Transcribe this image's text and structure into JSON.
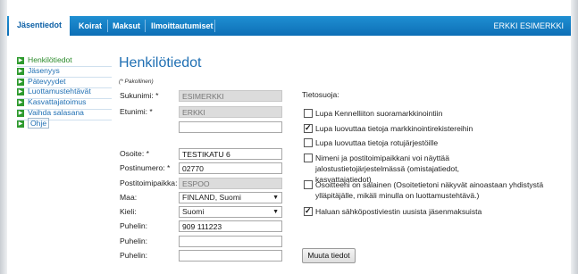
{
  "nav": {
    "tabs": [
      {
        "label": "Jäsentiedot"
      },
      {
        "label": "Koirat"
      },
      {
        "label": "Maksut"
      },
      {
        "label": "Ilmoittautumiset"
      }
    ],
    "user": "ERKKI ESIMERKKI"
  },
  "sidebar": {
    "items": [
      {
        "label": "Henkilötiedot"
      },
      {
        "label": "Jäsenyys"
      },
      {
        "label": "Pätevyydet"
      },
      {
        "label": "Luottamustehtävät"
      },
      {
        "label": "Kasvattajatoimus"
      },
      {
        "label": "Vaihda salasana"
      },
      {
        "label": "Ohje"
      }
    ]
  },
  "page": {
    "title": "Henkilötiedot",
    "required_note": "(* Pakollinen)"
  },
  "form": {
    "sukunimi_label": "Sukunimi: *",
    "sukunimi_value": "ESIMERKKI",
    "etunimi_label": "Etunimi: *",
    "etunimi_value": "ERKKI",
    "extra_name_value": "",
    "osoite_label": "Osoite: *",
    "osoite_value": "TESTIKATU 6",
    "postinumero_label": "Postinumero: *",
    "postinumero_value": "02770",
    "postitoimipaikka_label": "Postitoimipaikka:",
    "postitoimipaikka_value": "ESPOO",
    "maa_label": "Maa:",
    "maa_value": "FINLAND, Suomi",
    "kieli_label": "Kieli:",
    "kieli_value": "Suomi",
    "puhelin_label": "Puhelin:",
    "puhelin1_value": "909 111223",
    "puhelin2_value": "",
    "puhelin3_value": ""
  },
  "privacy": {
    "title": "Tietosuoja:",
    "options": [
      {
        "text": "Lupa Kennelliiton suoramarkkinointiin",
        "checked": false
      },
      {
        "text": "Lupa luovuttaa tietoja markkinointirekistereihin",
        "checked": true
      },
      {
        "text": "Lupa luovuttaa tietoja rotujärjestöille",
        "checked": false
      },
      {
        "text": "Nimeni ja postitoimipaikkani voi näyttää jalostustietojärjestelmässä (omistajatiedot, kasvattajatiedot)",
        "checked": false
      },
      {
        "text": "Osoitteeni on salainen (Osoitetietoni näkyvät ainoastaan yhdistystä ylläpitäjälle, mikäli minulla on luottamustehtävä.)",
        "checked": false
      },
      {
        "text": "Haluan sähköpostiviestin uusista jäsenmaksuista",
        "checked": true
      }
    ]
  },
  "actions": {
    "save_label": "Muuta tiedot"
  },
  "colors": {
    "nav_blue": "#0d6fb6",
    "link_blue": "#1f6fb3",
    "active_green": "#2a8a2a"
  }
}
